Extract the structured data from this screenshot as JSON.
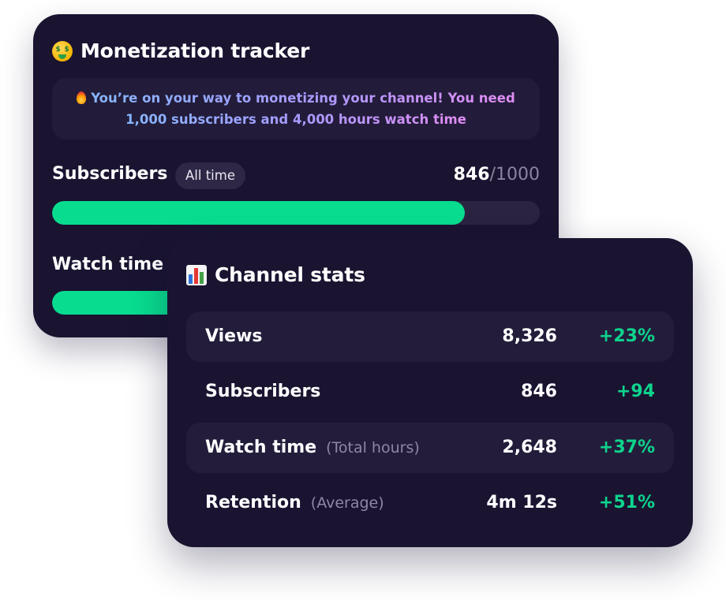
{
  "colors": {
    "card_background": "#1a1431",
    "row_highlight": "#231d3b",
    "progress_fill": "#08dd8f",
    "progress_track": "#2a2440",
    "positive_delta": "#0ed48d",
    "muted_text": "#8d88a3"
  },
  "monetization": {
    "title": "Monetization tracker",
    "title_icon": "money-mouth-face-icon",
    "notice_icon": "fire-icon",
    "notice_line1": "You’re on your way to monetizing your channel! You need",
    "notice_line2": "1,000 subscribers and 4,000 hours watch time",
    "subscribers": {
      "label": "Subscribers",
      "range_pill": "All time",
      "current": "846",
      "target": "/1000",
      "progress_fraction": 0.846
    },
    "watch_time": {
      "label": "Watch time",
      "progress_fraction": 0.66
    }
  },
  "stats": {
    "title": "Channel stats",
    "title_icon": "bar-chart-icon",
    "rows": [
      {
        "name": "Views",
        "sub": "",
        "value": "8,326",
        "delta": "+23%"
      },
      {
        "name": "Subscribers",
        "sub": "",
        "value": "846",
        "delta": "+94"
      },
      {
        "name": "Watch time",
        "sub": "(Total hours)",
        "value": "2,648",
        "delta": "+37%"
      },
      {
        "name": "Retention",
        "sub": "(Average)",
        "value": "4m 12s",
        "delta": "+51%"
      }
    ]
  }
}
